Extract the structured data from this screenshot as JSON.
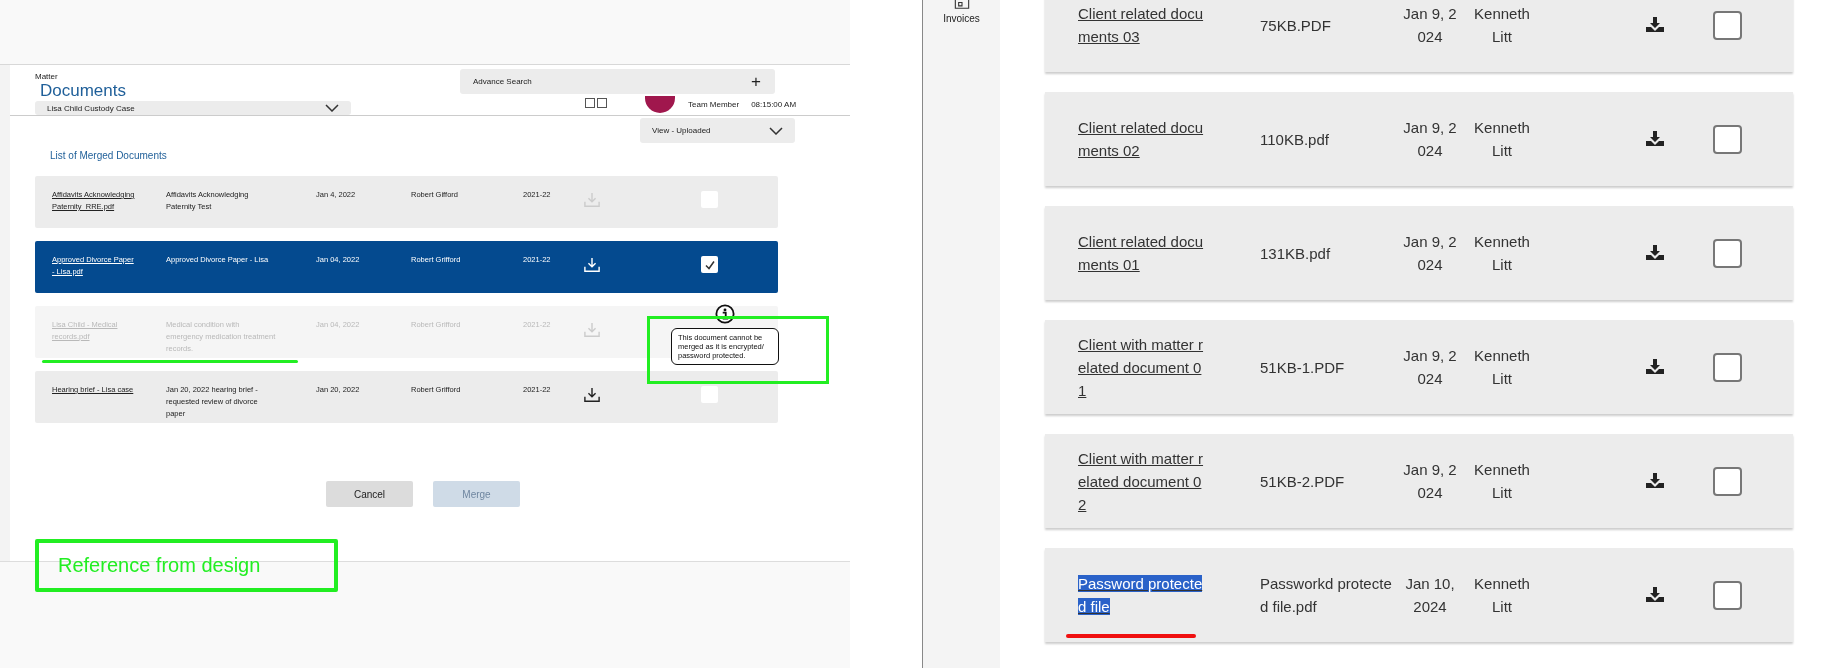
{
  "design_reference": {
    "header": {
      "matter_label": "Matter",
      "title": "Documents",
      "matter_select": "Lisa Child Custody Case",
      "advance_search": "Advance Search",
      "add_symbol": "+",
      "user_role": "Team Member",
      "time": "08:15:00 AM"
    },
    "view_select": "View - Uploaded",
    "list_title": "List of Merged Documents",
    "rows": [
      {
        "file": "Affidavits Acknowledging Paternity_RRE.pdf",
        "description": "Affidavits Acknowledging Paternity Test",
        "date": "Jan 4, 2022",
        "owner": "Robert Gifford",
        "year": "2021-22",
        "selected": false,
        "disabled": false,
        "download_enabled": false,
        "checked": false
      },
      {
        "file": "Approved Divorce Paper - Lisa.pdf",
        "description": "Approved Divorce Paper - Lisa",
        "date": "Jan 04, 2022",
        "owner": "Robert Grifford",
        "year": "2021-22",
        "selected": true,
        "disabled": false,
        "download_enabled": true,
        "checked": true
      },
      {
        "file": "Lisa Child - Medical records.pdf",
        "description": "Medical condition with emergency medication treatment records.",
        "date": "Jan 04, 2022",
        "owner": "Robert Grifford",
        "year": "2021-22",
        "selected": false,
        "disabled": true,
        "download_enabled": false
      },
      {
        "file": "Hearing brief - Lisa case",
        "description": "Jan 20, 2022 hearing brief - requested review of divorce paper",
        "date": "Jan 20, 2022",
        "owner": "Robert Grifford",
        "year": "2021-22",
        "selected": false,
        "disabled": false,
        "download_enabled": true,
        "checked": false
      }
    ],
    "tooltip": "This document cannot be merged as it is encrypted/ password protected.",
    "buttons": [
      {
        "label": "Cancel",
        "disabled": false
      },
      {
        "label": "Merge",
        "disabled": true
      }
    ]
  },
  "annotations": {
    "reference_label": "Reference from design"
  },
  "app": {
    "sidebar_item": "Invoices",
    "rows": [
      {
        "name": "Client related documents 03",
        "file": "75KB.PDF",
        "date": "Jan 9, 2024",
        "owner": "Kenneth Litt",
        "checked": false,
        "highlighted": false
      },
      {
        "name": "Client related documents 02",
        "file": "110KB.pdf",
        "date": "Jan 9, 2024",
        "owner": "Kenneth Litt",
        "checked": false,
        "highlighted": false
      },
      {
        "name": "Client related documents 01",
        "file": "131KB.pdf",
        "date": "Jan 9, 2024",
        "owner": "Kenneth Litt",
        "checked": false,
        "highlighted": false
      },
      {
        "name": "Client with matter related document 01",
        "file": "51KB-1.PDF",
        "date": "Jan 9, 2024",
        "owner": "Kenneth Litt",
        "checked": false,
        "highlighted": false
      },
      {
        "name": "Client with matter related document 02",
        "file": "51KB-2.PDF",
        "date": "Jan 9, 2024",
        "owner": "Kenneth Litt",
        "checked": false,
        "highlighted": false
      },
      {
        "name": "Password protected file",
        "file": "Passworkd protected file.pdf",
        "date": "Jan 10, 2024",
        "owner": "Kenneth Litt",
        "checked": false,
        "highlighted": true
      }
    ]
  }
}
